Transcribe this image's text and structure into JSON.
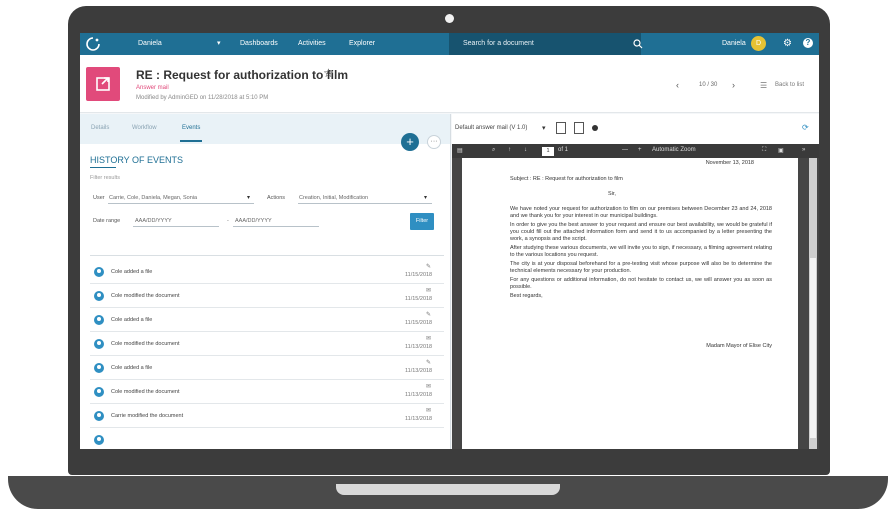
{
  "topbar": {
    "user": "Daniela",
    "nav": [
      "Dashboards",
      "Activities",
      "Explorer"
    ],
    "search_placeholder": "Search for a document",
    "user_name": "Daniela",
    "avatar_initial": "D",
    "brand_color": "#1f6f94"
  },
  "doc": {
    "title": "RE : Request for authorization to film",
    "type": "Answer mail",
    "modified": "Modified by AdminGED on 11/28/2018 at 5:10 PM",
    "pager": "10 / 30",
    "back": "Back to list"
  },
  "tabs": [
    "Details",
    "Workflow",
    "Events"
  ],
  "history": {
    "title": "HISTORY OF EVENTS",
    "filter_results": "Filter results",
    "user_label": "User",
    "user_value": "Carrie, Cole, Daniela, Megan, Sonia",
    "actions_label": "Actions",
    "actions_value": "Creation, Initial, Modification",
    "date_label": "Date range",
    "date_from": "AAA/DD/YYYY",
    "date_sep": "-",
    "date_to": "AAA/DD/YYYY",
    "filter_button": "Filter"
  },
  "events": [
    {
      "text": "Cole added a file",
      "date": "11/15/2018",
      "icon": "paperclip-icon"
    },
    {
      "text": "Cole modified the document",
      "date": "11/15/2018",
      "icon": "envelope-icon"
    },
    {
      "text": "Cole added a file",
      "date": "11/15/2018",
      "icon": "paperclip-icon"
    },
    {
      "text": "Cole modified the document",
      "date": "11/13/2018",
      "icon": "envelope-icon"
    },
    {
      "text": "Cole added a file",
      "date": "11/13/2018",
      "icon": "paperclip-icon"
    },
    {
      "text": "Cole modified the document",
      "date": "11/13/2018",
      "icon": "envelope-icon"
    },
    {
      "text": "Carrie modified the document",
      "date": "11/13/2018",
      "icon": "envelope-icon"
    }
  ],
  "viewer": {
    "model": "Default answer mail (V 1.0)",
    "page_of": "of 1",
    "page": "1",
    "zoom": "Automatic Zoom",
    "date": "November 13, 2018",
    "subject": "Subject : RE : Request for authorization to film",
    "salutation": "Sir,",
    "paragraphs": [
      "We have noted your request for authorization to film on our premises between December 23 and 24, 2018 and we thank you for your interest in our municipal buildings.",
      "In order to give you the best answer to your request and ensure our best availability, we would be grateful if you could fill out the attached information form and send it to us accompanied by a letter presenting the work, a synopsis and the script.",
      "After studying these various documents, we will invite you to sign, if necessary, a filming agreement relating to the various locations you request.",
      "The city is at your disposal beforehand for a pre-testing visit whose purpose will also be to determine the technical elements necessary for your production.",
      "For any questions or additional information, do not hesitate to contact us, we will answer you as soon as possible.",
      "Best regards,"
    ],
    "signature": "Madam Mayor of Elise City"
  }
}
